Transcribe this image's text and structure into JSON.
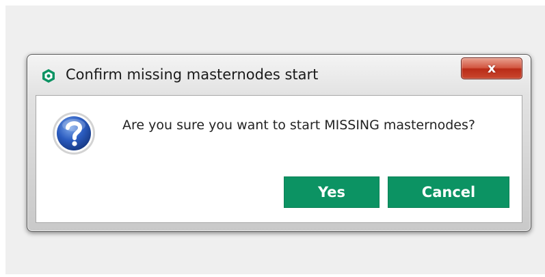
{
  "dialog": {
    "title": "Confirm missing masternodes start",
    "message": "Are you sure you want to start MISSING masternodes?",
    "close_label": "x",
    "buttons": {
      "yes": "Yes",
      "cancel": "Cancel"
    },
    "icons": {
      "app": "app-logo-icon",
      "message": "question-icon",
      "close": "close-icon"
    }
  },
  "colors": {
    "accent": "#0c9363",
    "close_button": "#c9472e",
    "question_icon": "#1f4fa8"
  }
}
